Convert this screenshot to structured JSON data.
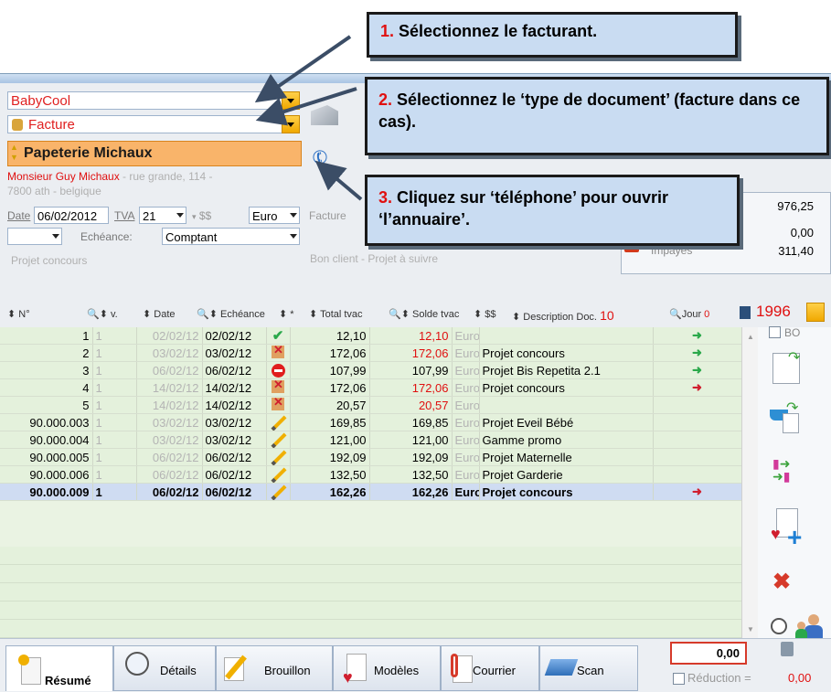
{
  "callouts": [
    {
      "num": "1.",
      "text": "Sélectionnez le facturant."
    },
    {
      "num": "2.",
      "text": "Sélectionnez le ‘type de document’ (facture dans ce cas)."
    },
    {
      "num": "3.",
      "text": "Cliquez sur ‘téléphone’ pour ouvrir ‘l’annuaire’."
    }
  ],
  "form": {
    "issuer": "BabyCool",
    "doc_type": "Facture",
    "client": "Papeterie Michaux",
    "contact_name": "Monsieur Guy Michaux",
    "contact_addr1": " - rue grande, 114 -",
    "contact_addr2": "7800 ath - belgique",
    "date_label": "Date",
    "date_value": "06/02/2012",
    "tva_label": "TVA",
    "tva_value": "21",
    "ss_label": "$$",
    "currency": "Euro",
    "facture_label": "Facture",
    "echeance_label": "Echéance:",
    "echeance_value": "Comptant",
    "project": "Projet concours",
    "client_note": "Bon client - Projet à suivre"
  },
  "summary": {
    "v1": "976,25",
    "v2": "0,00",
    "v3": "311,40",
    "impayes": "Impayés"
  },
  "header": {
    "no": "N°",
    "v": "v.",
    "date": "Date",
    "echeance": "Echéance",
    "star": "*",
    "total": "Total tvac",
    "solde": "Solde tvac",
    "ss": "$$",
    "desc": "Description",
    "doc": "Doc.",
    "doc_count": "10",
    "jour": "Jour",
    "jour_count": "0",
    "counter": "1996",
    "bo": "BO"
  },
  "rows": [
    {
      "no": "1",
      "v": "1",
      "date": "02/02/12",
      "ech": "02/02/12",
      "status": "check",
      "total": "12,10",
      "solde": "12,10",
      "solde_red": true,
      "cur": "Euro",
      "desc": "",
      "arrow": "green"
    },
    {
      "no": "2",
      "v": "1",
      "date": "03/02/12",
      "ech": "03/02/12",
      "status": "crossed",
      "total": "172,06",
      "solde": "172,06",
      "solde_red": true,
      "cur": "Euro",
      "desc": "Projet concours",
      "arrow": "green"
    },
    {
      "no": "3",
      "v": "1",
      "date": "06/02/12",
      "ech": "06/02/12",
      "status": "stop",
      "total": "107,99",
      "solde": "107,99",
      "solde_red": false,
      "cur": "Euro",
      "desc": "Projet Bis Repetita 2.1",
      "arrow": "green"
    },
    {
      "no": "4",
      "v": "1",
      "date": "14/02/12",
      "ech": "14/02/12",
      "status": "crossed",
      "total": "172,06",
      "solde": "172,06",
      "solde_red": true,
      "cur": "Euro",
      "desc": "Projet concours",
      "arrow": "red"
    },
    {
      "no": "5",
      "v": "1",
      "date": "14/02/12",
      "ech": "14/02/12",
      "status": "crossed",
      "total": "20,57",
      "solde": "20,57",
      "solde_red": true,
      "cur": "Euro",
      "desc": "",
      "arrow": ""
    },
    {
      "no": "90.000.003",
      "v": "1",
      "date": "03/02/12",
      "ech": "03/02/12",
      "status": "pencil",
      "total": "169,85",
      "solde": "169,85",
      "solde_red": false,
      "cur": "Euro",
      "desc": "Projet Eveil Bébé",
      "arrow": ""
    },
    {
      "no": "90.000.004",
      "v": "1",
      "date": "03/02/12",
      "ech": "03/02/12",
      "status": "pencil",
      "total": "121,00",
      "solde": "121,00",
      "solde_red": false,
      "cur": "Euro",
      "desc": "Gamme promo",
      "arrow": ""
    },
    {
      "no": "90.000.005",
      "v": "1",
      "date": "06/02/12",
      "ech": "06/02/12",
      "status": "pencil",
      "total": "192,09",
      "solde": "192,09",
      "solde_red": false,
      "cur": "Euro",
      "desc": "Projet Maternelle",
      "arrow": ""
    },
    {
      "no": "90.000.006",
      "v": "1",
      "date": "06/02/12",
      "ech": "06/02/12",
      "status": "pencil",
      "total": "132,50",
      "solde": "132,50",
      "solde_red": false,
      "cur": "Euro",
      "desc": "Projet Garderie",
      "arrow": ""
    },
    {
      "no": "90.000.009",
      "v": "1",
      "date": "06/02/12",
      "ech": "06/02/12",
      "status": "pencil",
      "total": "162,26",
      "solde": "162,26",
      "solde_red": false,
      "cur": "Euro",
      "desc": "Projet concours",
      "arrow": "red",
      "selected": true
    }
  ],
  "tabs": {
    "resume": "Résumé",
    "details": "Détails",
    "brouillon": "Brouillon",
    "modeles": "Modèles",
    "courrier": "Courrier",
    "scan": "Scan"
  },
  "footer": {
    "total": "0,00",
    "reduction_label": "Réduction =",
    "reduction_value": "0,00"
  }
}
